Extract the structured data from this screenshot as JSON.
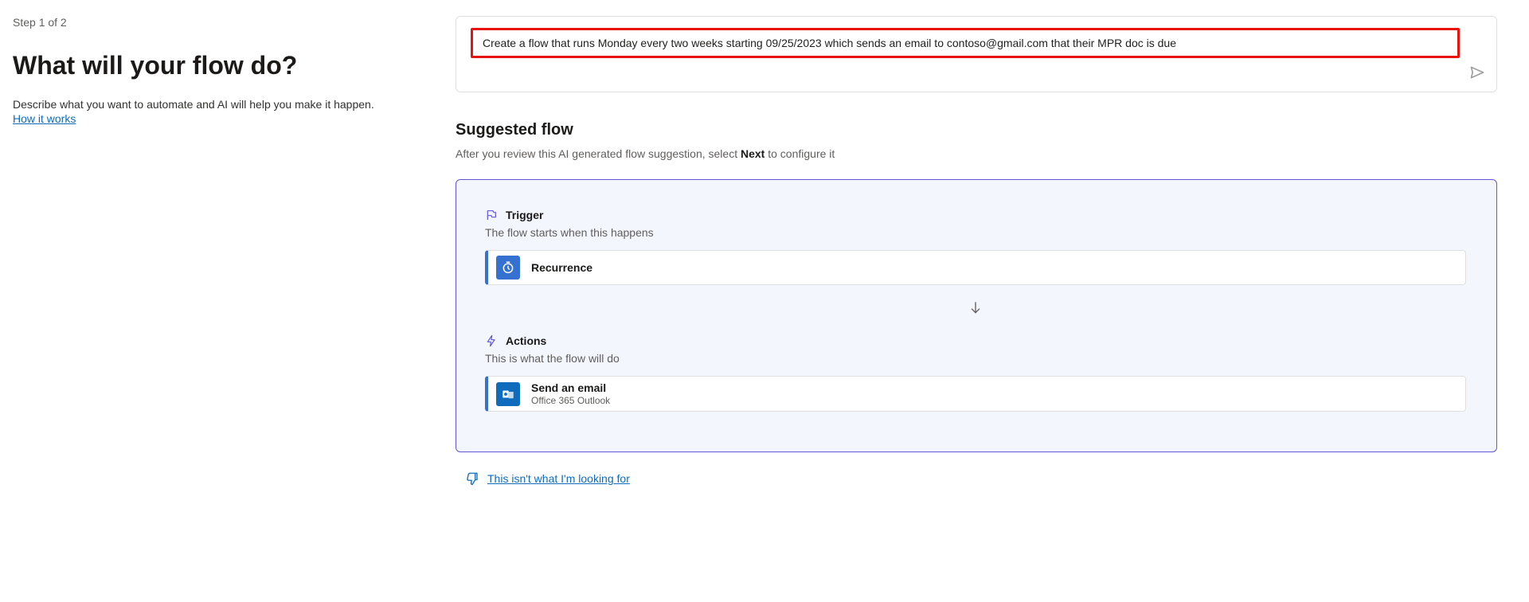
{
  "left": {
    "step_label": "Step 1 of 2",
    "heading": "What will your flow do?",
    "description": "Describe what you want to automate and AI will help you make it happen.",
    "how_link": "How it works"
  },
  "prompt": {
    "value": "Create a flow that runs Monday every two weeks starting 09/25/2023 which sends an email to contoso@gmail.com that their MPR doc is due"
  },
  "suggested": {
    "title": "Suggested flow",
    "sub_prefix": "After you review this AI generated flow suggestion, select ",
    "sub_bold": "Next",
    "sub_suffix": " to configure it",
    "trigger": {
      "label": "Trigger",
      "desc": "The flow starts when this happens",
      "step_title": "Recurrence"
    },
    "actions": {
      "label": "Actions",
      "desc": "This is what the flow will do",
      "step_title": "Send an email",
      "step_sub": "Office 365 Outlook"
    }
  },
  "feedback": {
    "link": "This isn't what I'm looking for"
  }
}
